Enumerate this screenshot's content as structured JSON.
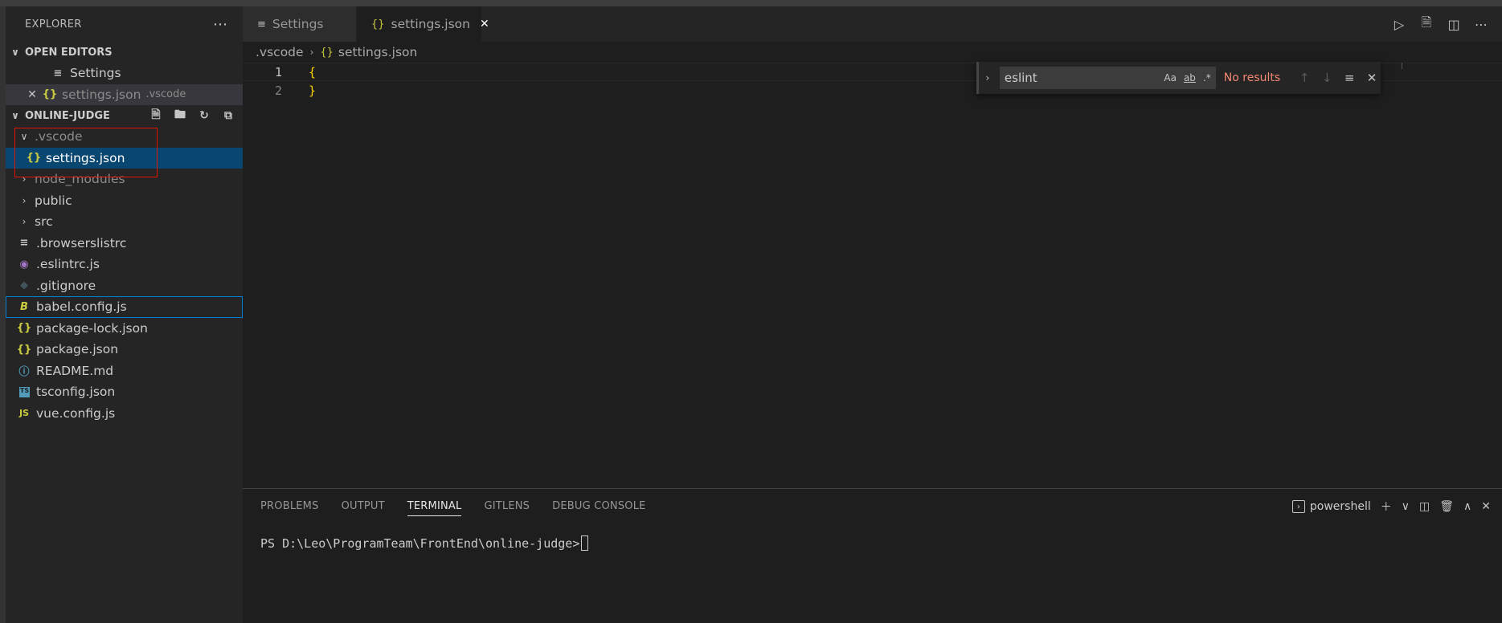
{
  "sidebar": {
    "title": "EXPLORER",
    "more_icon": "⋯",
    "open_editors": {
      "header": "OPEN EDITORS",
      "items": [
        {
          "icon": "≡",
          "label": "Settings",
          "desc": ""
        },
        {
          "icon": "{}",
          "label": "settings.json",
          "desc": ".vscode",
          "close": "✕"
        }
      ]
    },
    "project": {
      "header": "ONLINE-JUDGE",
      "items": [
        {
          "label": ".vscode",
          "chevron": "∨"
        },
        {
          "label": "settings.json",
          "icon": "{}"
        },
        {
          "label": "node_modules",
          "chevron": "›"
        },
        {
          "label": "public",
          "chevron": "›"
        },
        {
          "label": "src",
          "chevron": "›"
        },
        {
          "label": ".browserslistrc",
          "icon": "≡"
        },
        {
          "label": ".eslintrc.js",
          "icon": "◉"
        },
        {
          "label": ".gitignore",
          "icon": "◆"
        },
        {
          "label": "babel.config.js",
          "icon": "B"
        },
        {
          "label": "package-lock.json",
          "icon": "{}"
        },
        {
          "label": "package.json",
          "icon": "{}"
        },
        {
          "label": "README.md",
          "icon": "ⓘ"
        },
        {
          "label": "tsconfig.json",
          "icon": "TS"
        },
        {
          "label": "vue.config.js",
          "icon": "JS"
        }
      ]
    }
  },
  "tabs": [
    {
      "icon": "≡",
      "label": "Settings"
    },
    {
      "icon": "{}",
      "label": "settings.json",
      "close": "✕"
    }
  ],
  "breadcrumb": {
    "folder": ".vscode",
    "sep": "›",
    "icon": "{}",
    "file": "settings.json"
  },
  "editor": {
    "lines": [
      {
        "number": "1",
        "text": "{"
      },
      {
        "number": "2",
        "text": "}"
      }
    ]
  },
  "find": {
    "query": "eslint",
    "match_case": "Aa",
    "whole_word": "ab",
    "regex": ".*",
    "status": "No results",
    "toggle": "›",
    "prev": "↑",
    "next": "↓",
    "selection": "≡",
    "close": "✕"
  },
  "panel": {
    "tabs": [
      "PROBLEMS",
      "OUTPUT",
      "TERMINAL",
      "GITLENS",
      "DEBUG CONSOLE"
    ],
    "active_tab": "TERMINAL",
    "shell": "powershell",
    "terminal_prompt": "PS D:\\Leo\\ProgramTeam\\FrontEnd\\online-judge>"
  },
  "colors": {
    "selection": "#094771",
    "focus_border": "#007fd4",
    "highlight_box": "#e51400",
    "json_icon": "#cbcb41",
    "no_results": "#f48771"
  }
}
